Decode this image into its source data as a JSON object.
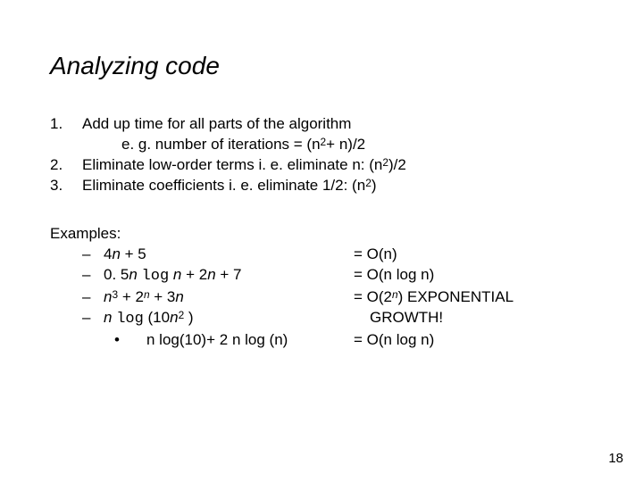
{
  "title": "Analyzing code",
  "steps": {
    "n1": "1.",
    "t1": "Add up time for all parts of the algorithm",
    "sub1_a": "e. g. number of iterations = (n",
    "sub1_b": "+ n)/2",
    "n2": "2.",
    "t2_a": "Eliminate low-order terms i. e. eliminate n: (n",
    "t2_b": ")/2",
    "n3": "3.",
    "t3_a": "Eliminate coefficients i. e. eliminate 1/2: (n",
    "t3_b": ")"
  },
  "examples_label": "Examples:",
  "dash": "–",
  "bullet": "•",
  "ex": {
    "e1_l": "4",
    "e1_n": "n",
    "e1_r": " + 5",
    "o1": "= O(n)",
    "e2_a": "0. 5",
    "e2_n1": "n ",
    "e2_log": "log",
    "e2_n2": " n",
    "e2_b": " + 2",
    "e2_n3": "n",
    "e2_c": " + 7",
    "o2": "= O(n log n)",
    "e3_n1": "n",
    "e3_a": " + 2",
    "e3_supn": "n",
    "e3_b": " + 3",
    "e3_n2": "n",
    "o3_a": "= O(2",
    "o3_supn": "n",
    "o3_b": ")  EXPONENTIAL",
    "o3_growth": "GROWTH!",
    "e4_sp": " ",
    "e4_n1": "n ",
    "e4_log": "log",
    "e4_a": " (10",
    "e4_n2": "n",
    "e4_b": " )",
    "e5_a": "n log(10)",
    "e5_b": "+ 2",
    "e5_c": "n log (n)",
    "o5": "= O(n log n)"
  },
  "two": "2",
  "three": "3",
  "pagenum": "18"
}
